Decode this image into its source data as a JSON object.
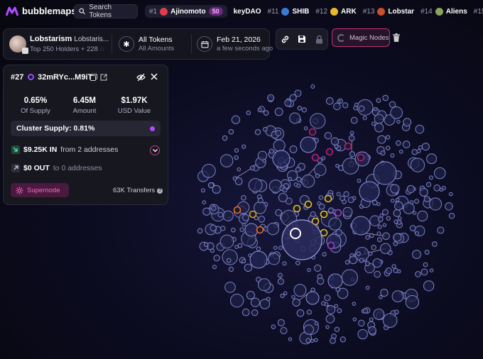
{
  "app": {
    "name": "bubblemaps",
    "accent": "#c2307a"
  },
  "search": {
    "label": "Search Tokens"
  },
  "ticker": [
    {
      "rank": "#1",
      "name": "Ajinomoto",
      "boost": "50",
      "color": "#e23b4e",
      "highlight": true
    },
    {
      "rank": "",
      "name": "keyDAO",
      "color": "",
      "highlight": false
    },
    {
      "rank": "#11",
      "name": "SHIB",
      "color": "#3a7bd5",
      "highlight": false
    },
    {
      "rank": "#12",
      "name": "ARK",
      "color": "#e8b92a",
      "highlight": false
    },
    {
      "rank": "#13",
      "name": "Lobstar",
      "color": "#c8512a",
      "highlight": false
    },
    {
      "rank": "#14",
      "name": "Aliens",
      "color": "#8aa35a",
      "highlight": false
    },
    {
      "rank": "#15",
      "name": "",
      "color": "",
      "highlight": false
    }
  ],
  "token": {
    "name": "Lobstarism",
    "symbol": "Lobstaris...",
    "holders": "Top 250 Holders + 228",
    "filter_label": "All Tokens",
    "filter_sub": "All Amounts",
    "date": "Feb 21, 2026",
    "date_sub": "a few seconds ago"
  },
  "toolbar": {
    "magic_label": "Magic Nodes"
  },
  "panel": {
    "rank": "#27",
    "address": "32mRYc...M9iT",
    "stats": [
      {
        "value": "0.65%",
        "label": "Of Supply"
      },
      {
        "value": "6.45M",
        "label": "Amount"
      },
      {
        "value": "$1.97K",
        "label": "USD Value"
      }
    ],
    "cluster": "Cluster Supply: 0.81%",
    "inflow": {
      "amount": "$9.25K IN",
      "from": "from 2 addresses"
    },
    "outflow": {
      "amount": "$0 OUT",
      "from": "to 0 addresses"
    },
    "supernode_label": "Supernode",
    "transfers": "63K Transfers"
  }
}
